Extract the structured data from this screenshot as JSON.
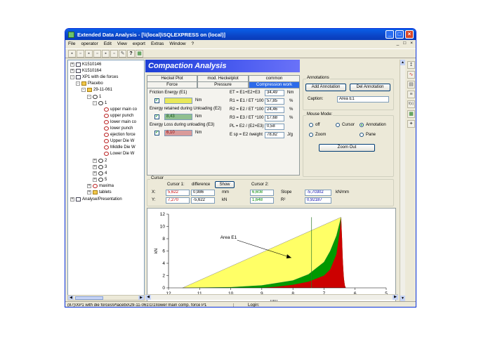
{
  "window": {
    "title": "Extended Data Analysis - [\\\\(local)\\SQLEXPRESS on (local)]",
    "buttons": {
      "minimize": "_",
      "maximize": "□",
      "close": "×"
    }
  },
  "menu": [
    "File",
    "operator",
    "Edit",
    "View",
    "export",
    "Extras",
    "Window",
    "?"
  ],
  "mdi_controls": [
    "_",
    "□",
    "×"
  ],
  "tree": {
    "items": [
      {
        "label": "K1510146",
        "indent": 0,
        "exp": "+",
        "icon": "doc"
      },
      {
        "label": "K1510164",
        "indent": 0,
        "exp": "+",
        "icon": "doc"
      },
      {
        "label": "XP1 with die forces",
        "indent": 0,
        "exp": "-",
        "icon": "doc"
      },
      {
        "label": "Placebo",
        "indent": 1,
        "exp": "-",
        "icon": "folder"
      },
      {
        "label": "29-11-061",
        "indent": 2,
        "exp": "-",
        "icon": "folder"
      },
      {
        "label": "1",
        "indent": 3,
        "exp": "-",
        "icon": "ring"
      },
      {
        "label": "1",
        "indent": 4,
        "exp": "-",
        "icon": "ring"
      },
      {
        "label": "upper main co",
        "indent": 5,
        "exp": "",
        "icon": "curve"
      },
      {
        "label": "upper punch",
        "indent": 5,
        "exp": "",
        "icon": "curve"
      },
      {
        "label": "lower main co",
        "indent": 5,
        "exp": "",
        "icon": "curve"
      },
      {
        "label": "lower punch",
        "indent": 5,
        "exp": "",
        "icon": "curve"
      },
      {
        "label": "ejection force",
        "indent": 5,
        "exp": "",
        "icon": "curve"
      },
      {
        "label": "Upper Die W",
        "indent": 5,
        "exp": "",
        "icon": "curve"
      },
      {
        "label": "Middle Die W",
        "indent": 5,
        "exp": "",
        "icon": "curve"
      },
      {
        "label": "Lower Die W",
        "indent": 5,
        "exp": "",
        "icon": "curve"
      },
      {
        "label": "2",
        "indent": 4,
        "exp": "+",
        "icon": "ring"
      },
      {
        "label": "3",
        "indent": 4,
        "exp": "+",
        "icon": "ring"
      },
      {
        "label": "4",
        "indent": 4,
        "exp": "+",
        "icon": "ring"
      },
      {
        "label": "5",
        "indent": 4,
        "exp": "+",
        "icon": "ring"
      },
      {
        "label": "maxima",
        "indent": 3,
        "exp": "+",
        "icon": "curve"
      },
      {
        "label": "tablets",
        "indent": 3,
        "exp": "+",
        "icon": "folder"
      },
      {
        "label": "Analyse/Presentation",
        "indent": 0,
        "exp": "+",
        "icon": "doc"
      }
    ]
  },
  "banner": "Compaction Analysis",
  "tabs": {
    "row1": [
      "Heckel Plot",
      "mod. Heckelplot",
      "common"
    ],
    "row2": [
      "Force",
      "Pressure",
      "Compression work"
    ],
    "active": "Compression work"
  },
  "compression": {
    "friction_label": "Friction Energy (E1)",
    "friction_value": "",
    "unit_nm": "Nm",
    "retained_label": "Energy retained during Unloading (E2)",
    "retained_value": "8,43",
    "loss_label": "Energy Loss during unloading (E3)",
    "loss_value": "6,10",
    "et_formula": "ET = E1+E2+E3",
    "et_value": "34,49",
    "r1_formula": "R1 = E1 / ET *100",
    "r1_value": "57,85",
    "r2_formula": "R2 = E2 / ET *100",
    "r2_value": "24,46",
    "r3_formula": "R3 = E3 / ET *100",
    "r3_value": "17,68",
    "pct": "%",
    "pl_formula": "PL = E2 / (E2+E3)",
    "pl_value": "0,58",
    "esp_formula": "E sp = E2 /weight",
    "esp_value": "78,82",
    "esp_unit": "J/g"
  },
  "annotations": {
    "group_label": "Annotations",
    "add_button": "Add Annotation",
    "del_button": "Del Annotation",
    "caption_label": "Caption:",
    "caption_value": "Area E1"
  },
  "mouse_mode": {
    "group_label": "Mouse Mode:",
    "options": [
      "off",
      "Cursor",
      "Annotation",
      "Zoom",
      "Pane"
    ],
    "selected": "Annotation",
    "zoom_out": "Zoom Out"
  },
  "cursor": {
    "group_label": "Cursor",
    "cursor1_label": "Cursor 1:",
    "difference_label": "difference",
    "show_button": "Show",
    "cursor2_label": "Cursor 2:",
    "x_label": "X:",
    "y_label": "Y:",
    "x1": "5,622",
    "dx": "0,986",
    "x_unit": "mm",
    "x2": "6,608",
    "slope_label": "Slope",
    "slope_value": "-5,70302",
    "slope_unit": "kN/mm",
    "y1": "7,270",
    "dy": "-5,622",
    "y_unit": "kN",
    "y2": "1,648",
    "r2_label": "R²",
    "r2_value": "0,92187"
  },
  "status": {
    "path": "(87)\\XP1 with die forces\\Placebo\\29-11-061\\1\\1\\lower main comp. force P1",
    "login": "Login:"
  },
  "chart_data": {
    "type": "area",
    "xlabel": "mm",
    "ylabel": "kN",
    "xlim": [
      12,
      5
    ],
    "ylim": [
      0,
      12
    ],
    "x_ticks": [
      12,
      11,
      10,
      9,
      8,
      7,
      6,
      5
    ],
    "y_ticks": [
      0,
      2,
      4,
      6,
      8,
      10,
      12
    ],
    "series": [
      {
        "color": "#ffff66",
        "x": [
          11.55,
          6.45
        ],
        "y": [
          0,
          11.5
        ]
      },
      {
        "color": "#009900",
        "x": [
          11.55,
          10.0,
          9.0,
          8.0,
          7.5,
          7.0,
          6.8,
          6.6,
          6.5,
          6.45
        ],
        "y": [
          0,
          0.1,
          0.4,
          1.2,
          2.2,
          4.2,
          6.0,
          8.5,
          10.5,
          11.5
        ]
      },
      {
        "color": "#cc0000",
        "x": [
          6.45,
          6.42,
          6.4,
          6.38,
          6.36,
          6.33,
          6.3
        ],
        "y": [
          11.5,
          8.0,
          5.0,
          3.0,
          1.5,
          0.4,
          0
        ]
      }
    ],
    "vertical_cursor_x": 7.4,
    "annotation": {
      "text": "Area E1",
      "x": 10.2,
      "y": 8.0,
      "arrow_to_x": 8.05,
      "arrow_to_y": 4.9
    }
  }
}
